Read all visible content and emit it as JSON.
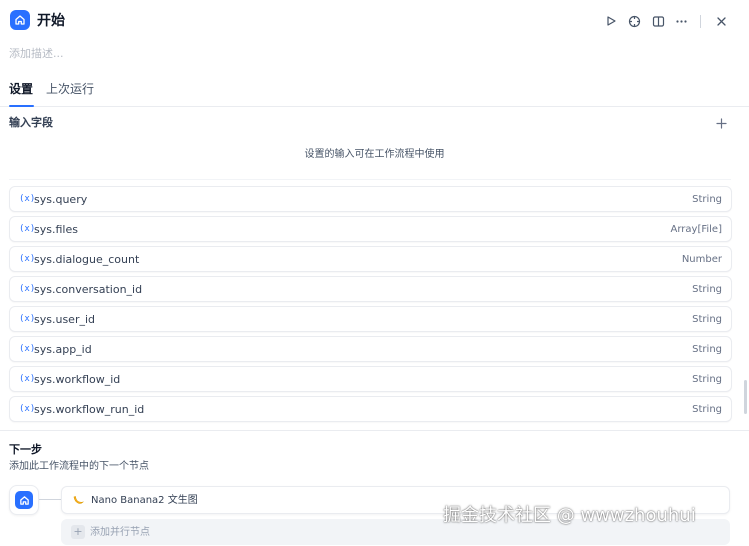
{
  "header": {
    "title": "开始",
    "description_placeholder": "添加描述...",
    "icons": [
      "home-icon",
      "play-icon",
      "crosshair-icon",
      "panel-icon",
      "more-icon",
      "close-icon"
    ]
  },
  "tabs": [
    {
      "label": "设置",
      "active": true
    },
    {
      "label": "上次运行",
      "active": false
    }
  ],
  "input_fields": {
    "title": "输入字段",
    "hint": "设置的输入可在工作流程中使用",
    "var_icon": "(x)",
    "variables": [
      {
        "name": "sys.query",
        "type": "String"
      },
      {
        "name": "sys.files",
        "type": "Array[File]"
      },
      {
        "name": "sys.dialogue_count",
        "type": "Number"
      },
      {
        "name": "sys.conversation_id",
        "type": "String"
      },
      {
        "name": "sys.user_id",
        "type": "String"
      },
      {
        "name": "sys.app_id",
        "type": "String"
      },
      {
        "name": "sys.workflow_id",
        "type": "String"
      },
      {
        "name": "sys.workflow_run_id",
        "type": "String"
      }
    ]
  },
  "next_step": {
    "title": "下一步",
    "subtitle": "添加此工作流程中的下一个节点",
    "next_node": "Nano Banana2 文生图",
    "add_parallel": "添加并行节点"
  },
  "watermark": "掘金技术社区 @ wwwzhouhui",
  "colors": {
    "accent": "#2970ff",
    "border": "#eaecf0",
    "muted": "#667085"
  }
}
